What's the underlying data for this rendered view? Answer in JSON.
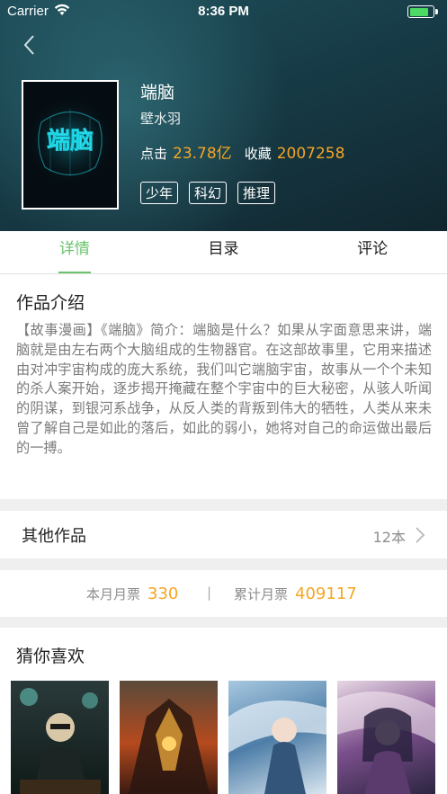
{
  "status_bar": {
    "carrier": "Carrier",
    "time": "8:36 PM",
    "battery_level": 0.8
  },
  "book": {
    "title": "端脑",
    "author": "壁水羽",
    "clicks_label": "点击",
    "clicks_value": "23.78亿",
    "favorites_label": "收藏",
    "favorites_value": "2007258",
    "tags": [
      "少年",
      "科幻",
      "推理"
    ],
    "cover_text": "端脑"
  },
  "tabs": [
    {
      "label": "详情",
      "active": true
    },
    {
      "label": "目录",
      "active": false
    },
    {
      "label": "评论",
      "active": false
    }
  ],
  "intro": {
    "heading": "作品介绍",
    "text": "【故事漫画】《端脑》简介：端脑是什么？如果从字面意思来讲，端脑就是由左右两个大脑组成的生物器官。在这部故事里，它用来描述由对冲宇宙构成的庞大系统，我们叫它端脑宇宙，故事从一个个未知的杀人案开始，逐步揭开掩藏在整个宇宙中的巨大秘密，从骇人听闻的阴谋，到银河系战争，从反人类的背叛到伟大的牺牲，人类从来未曾了解自己是如此的落后，如此的弱小，她将对自己的命运做出最后的一搏。"
  },
  "other_works": {
    "label": "其他作品",
    "count": "12本"
  },
  "monthly_tickets": {
    "this_month_label": "本月月票",
    "this_month_value": "330",
    "separator": "|",
    "total_label": "累计月票",
    "total_value": "409117"
  },
  "recommend": {
    "heading": "猜你喜欢"
  },
  "colors": {
    "accent_green": "#6bc46d",
    "accent_orange": "#f5a623",
    "header_bg": "#173c47"
  }
}
